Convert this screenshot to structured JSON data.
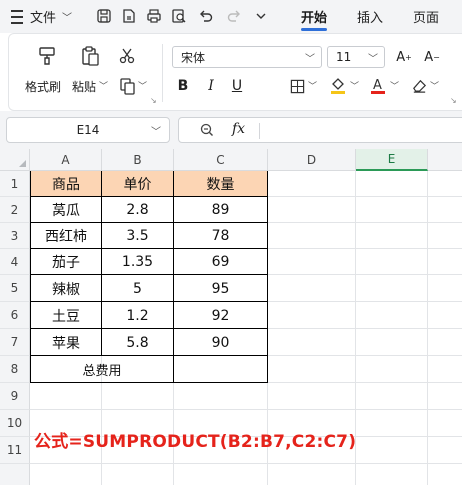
{
  "menubar": {
    "file_label": "文件",
    "tabs": [
      {
        "label": "开始",
        "active": true
      },
      {
        "label": "插入",
        "active": false
      },
      {
        "label": "页面",
        "active": false
      }
    ]
  },
  "ribbon": {
    "format_painter": "格式刷",
    "paste": "粘贴",
    "font_name": "宋体",
    "font_size": "11",
    "font_color": "#e5231b",
    "fill_color": "#f5c518"
  },
  "formula_bar": {
    "name_box": "E14",
    "fx_label": "fx",
    "formula": ""
  },
  "sheet": {
    "columns": [
      "A",
      "B",
      "C",
      "D",
      "E"
    ],
    "selected_column": "E",
    "rows": [
      "1",
      "2",
      "3",
      "4",
      "5",
      "6",
      "7",
      "8",
      "9",
      "10",
      "11"
    ],
    "header": [
      "商品",
      "单价",
      "数量"
    ],
    "data": [
      [
        "莴瓜",
        "2.8",
        "89"
      ],
      [
        "西红柿",
        "3.5",
        "78"
      ],
      [
        "茄子",
        "1.35",
        "69"
      ],
      [
        "辣椒",
        "5",
        "95"
      ],
      [
        "土豆",
        "1.2",
        "92"
      ],
      [
        "苹果",
        "5.8",
        "90"
      ]
    ],
    "total_label": "总费用",
    "total_value": "",
    "header_fill": "#fcd5b4",
    "note": "公式=SUMPRODUCT(B2:B7,C2:C7)",
    "note_color": "#e5231b"
  }
}
